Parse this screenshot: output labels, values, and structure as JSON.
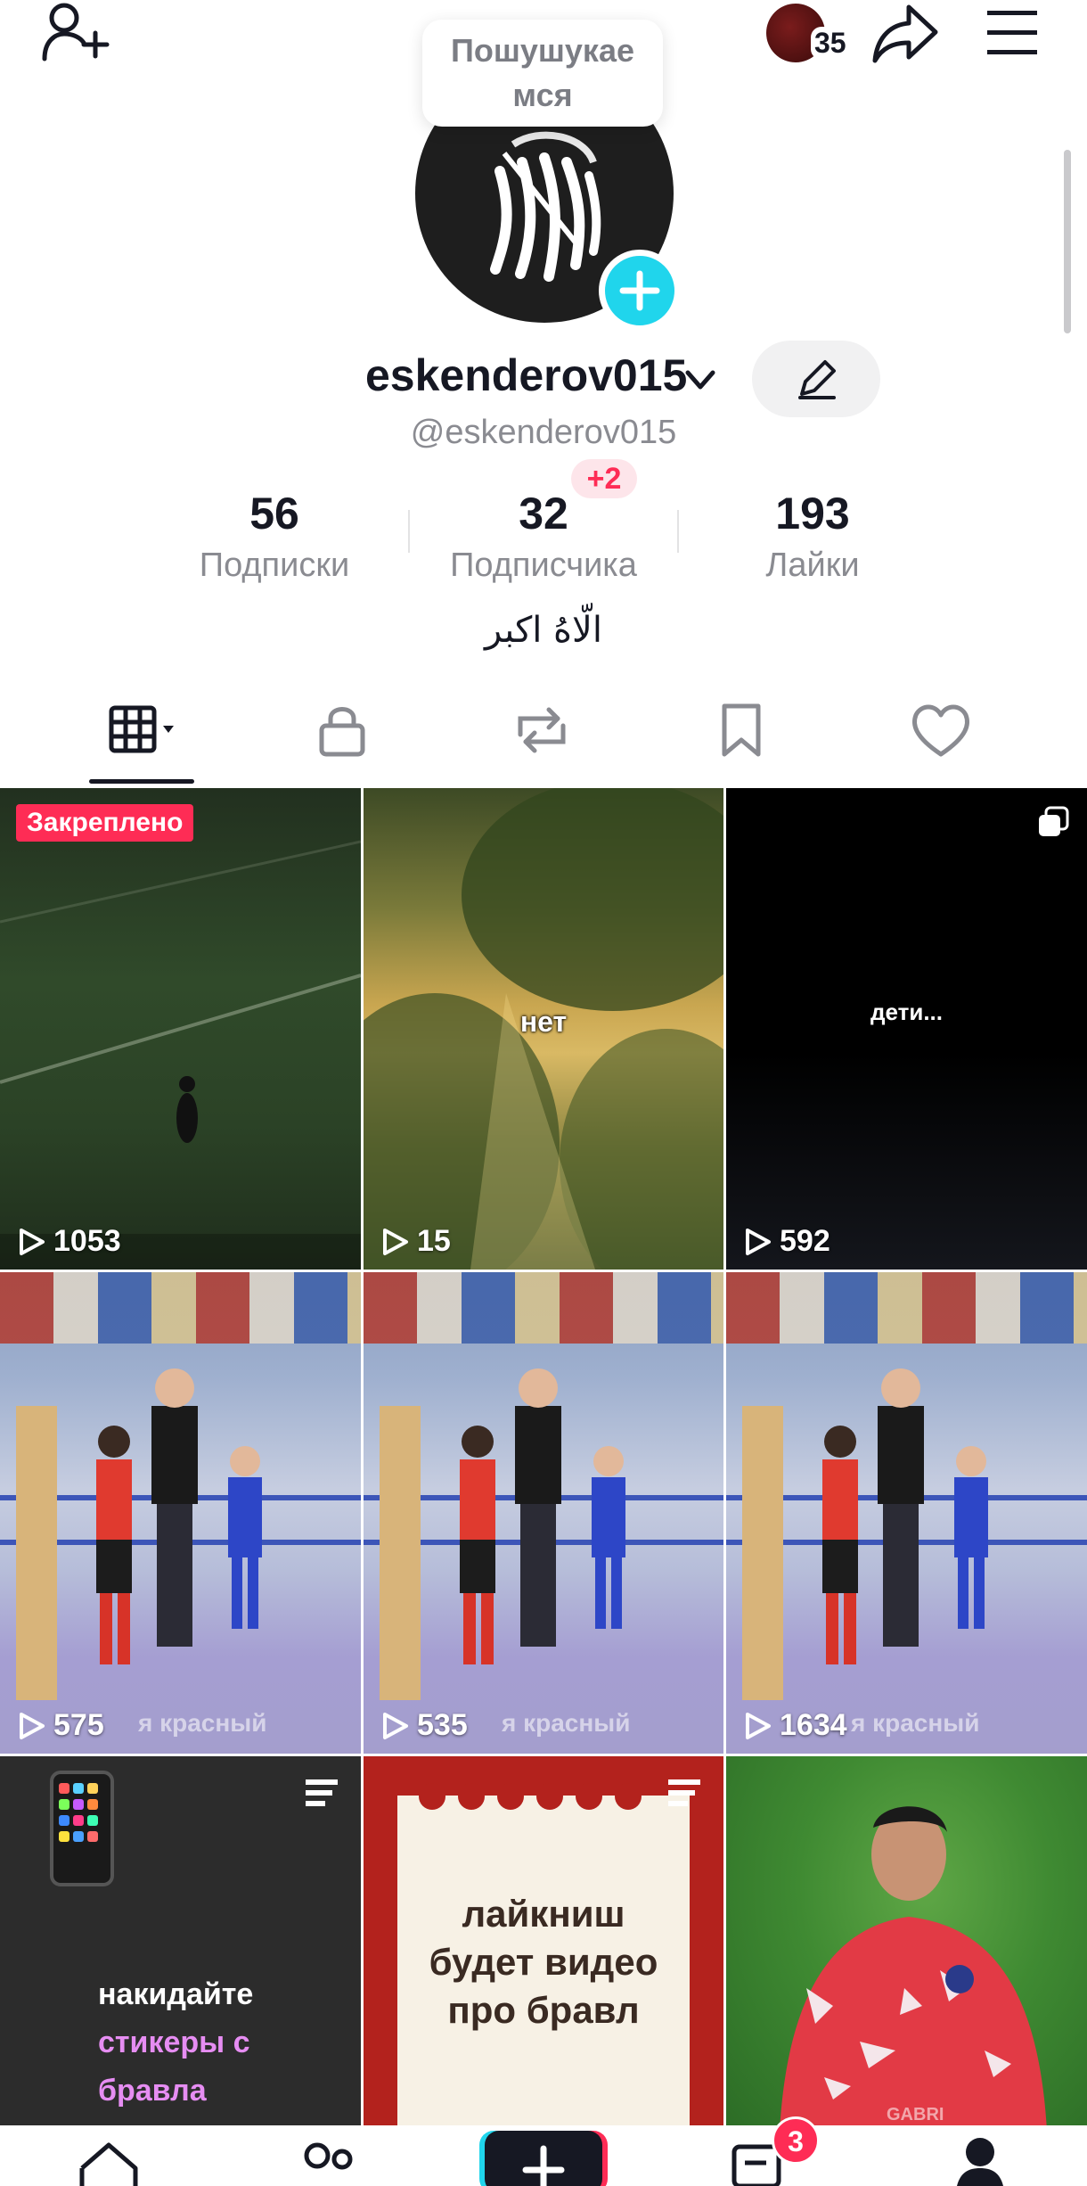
{
  "header": {
    "story_count": "35",
    "tooltip_text": "Пошушукае\nмся"
  },
  "profile": {
    "username": "eskenderov015",
    "handle": "@eskenderov015",
    "bio": "الّاهُ اكبر"
  },
  "stats": [
    {
      "value": "56",
      "label": "Подписки"
    },
    {
      "value": "32",
      "label": "Подписчика",
      "badge": "+2"
    },
    {
      "value": "193",
      "label": "Лайки"
    }
  ],
  "tabs": [
    "videos-grid",
    "private",
    "reposts",
    "favorites",
    "liked"
  ],
  "videos": [
    {
      "views": "1053",
      "pinned_label": "Закреплено"
    },
    {
      "views": "15",
      "overlay": "нет"
    },
    {
      "views": "592",
      "overlay": "дети..."
    },
    {
      "views": "575",
      "watermark": "я красный"
    },
    {
      "views": "535",
      "watermark": "я красный"
    },
    {
      "views": "1634",
      "watermark": "я красный"
    },
    {
      "text_lines": [
        "накидайте",
        "стикеры с",
        "бравла"
      ]
    },
    {
      "text_lines": [
        "лайкниш",
        "будет видео",
        "про бравл"
      ]
    },
    {
      "watermark": "GABRI"
    }
  ],
  "bottom_nav": {
    "inbox_badge": "3"
  },
  "colors": {
    "accent_pink": "#fe2c55",
    "accent_cyan": "#20d5ec",
    "text_primary": "#161823",
    "text_secondary": "#8a8b91"
  }
}
